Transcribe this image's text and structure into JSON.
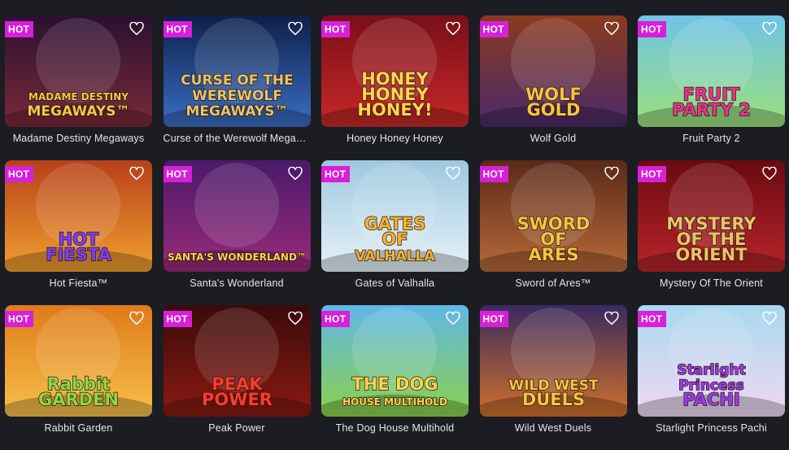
{
  "badge_label": "HOT",
  "games": [
    {
      "name": "Madame Destiny Megaways",
      "logo": [
        "MADAME DESTINY",
        "MEGAWAYS™"
      ],
      "bg": [
        "#2a1030",
        "#7a2a3a"
      ],
      "logo_color": "#f2c94c",
      "icon": "heart-outline-icon"
    },
    {
      "name": "Curse of the Werewolf Megaways",
      "logo": [
        "CURSE OF THE",
        "WEREWOLF",
        "MEGAWAYS™"
      ],
      "bg": [
        "#0d1f4a",
        "#3a6fc4"
      ],
      "logo_color": "#e9c46a",
      "icon": "heart-outline-icon"
    },
    {
      "name": "Honey Honey Honey",
      "logo": [
        "HONEY",
        "HONEY",
        "HONEY!"
      ],
      "bg": [
        "#7a0f18",
        "#c62828"
      ],
      "logo_color": "#ffd54f",
      "icon": "heart-outline-icon"
    },
    {
      "name": "Wolf Gold",
      "logo": [
        "WOLF",
        "GOLD"
      ],
      "bg": [
        "#8a3a1e",
        "#4a2a6a"
      ],
      "logo_color": "#f4c542",
      "icon": "heart-outline-icon"
    },
    {
      "name": "Fruit Party 2",
      "logo": [
        "FRUIT",
        "PARTY 2"
      ],
      "bg": [
        "#6fc3e8",
        "#9be07a"
      ],
      "logo_color": "#e8338c",
      "icon": "heart-outline-icon"
    },
    {
      "name": "Hot Fiesta™",
      "logo": [
        "HOT",
        "FIESTA"
      ],
      "bg": [
        "#b8401a",
        "#f0a030"
      ],
      "logo_color": "#7b3cff",
      "icon": "heart-outline-icon"
    },
    {
      "name": "Santa's Wonderland",
      "logo": [
        "SANTA'S WONDERLAND™"
      ],
      "bg": [
        "#4a1a6a",
        "#9a2a7a"
      ],
      "logo_color": "#ffd54f",
      "icon": "heart-outline-icon"
    },
    {
      "name": "Gates of Valhalla",
      "logo": [
        "GATES",
        "OF",
        "VALHALLA"
      ],
      "bg": [
        "#9ec8e0",
        "#e6f2f8"
      ],
      "logo_color": "#f2b233",
      "icon": "heart-outline-icon"
    },
    {
      "name": "Sword of Ares™",
      "logo": [
        "SWORD",
        "OF",
        "ARES"
      ],
      "bg": [
        "#5a2a18",
        "#b86a3a"
      ],
      "logo_color": "#f4c542",
      "icon": "heart-outline-icon"
    },
    {
      "name": "Mystery Of The Orient",
      "logo": [
        "MYSTERY",
        "OF THE",
        "ORIENT"
      ],
      "bg": [
        "#6a0a10",
        "#b8242a"
      ],
      "logo_color": "#e9c46a",
      "icon": "heart-outline-icon"
    },
    {
      "name": "Rabbit Garden",
      "logo": [
        "Rabbit",
        "GARDEN"
      ],
      "bg": [
        "#e07a1a",
        "#f6c04a"
      ],
      "logo_color": "#8bd84a",
      "icon": "heart-outline-icon"
    },
    {
      "name": "Peak Power",
      "logo": [
        "PEAK",
        "POWER"
      ],
      "bg": [
        "#3a0a0a",
        "#8a1a12"
      ],
      "logo_color": "#ff3b2f",
      "icon": "heart-outline-icon"
    },
    {
      "name": "The Dog House Multihold",
      "logo": [
        "THE DOG",
        "HOUSE MULTIHOLD"
      ],
      "bg": [
        "#5fb8e8",
        "#8bd04a"
      ],
      "logo_color": "#ffd54f",
      "icon": "heart-outline-icon"
    },
    {
      "name": "Wild West Duels",
      "logo": [
        "WILD WEST",
        "DUELS"
      ],
      "bg": [
        "#3a2a60",
        "#d0702a"
      ],
      "logo_color": "#f4c542",
      "icon": "heart-outline-icon"
    },
    {
      "name": "Starlight Princess Pachi",
      "logo": [
        "Starlight",
        "Princess",
        "PACHI"
      ],
      "bg": [
        "#a8d8f0",
        "#f0d8f0"
      ],
      "logo_color": "#9a3ae8",
      "icon": "heart-outline-icon"
    }
  ]
}
